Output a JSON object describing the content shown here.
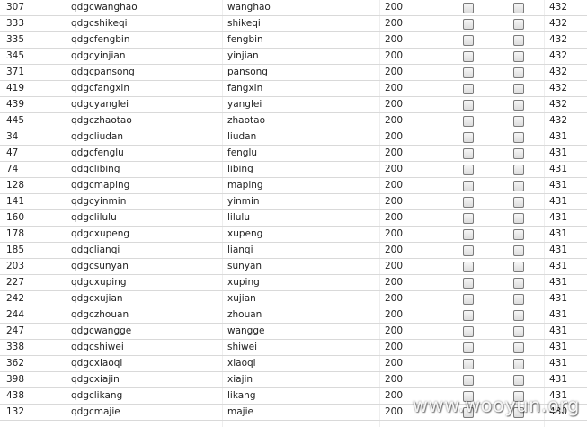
{
  "rows": [
    {
      "id": "307",
      "user": "qdgcwanghao",
      "name": "wanghao",
      "code": "200",
      "num": "432"
    },
    {
      "id": "333",
      "user": "qdgcshikeqi",
      "name": "shikeqi",
      "code": "200",
      "num": "432"
    },
    {
      "id": "335",
      "user": "qdgcfengbin",
      "name": "fengbin",
      "code": "200",
      "num": "432"
    },
    {
      "id": "345",
      "user": "qdgcyinjian",
      "name": "yinjian",
      "code": "200",
      "num": "432"
    },
    {
      "id": "371",
      "user": "qdgcpansong",
      "name": "pansong",
      "code": "200",
      "num": "432"
    },
    {
      "id": "419",
      "user": "qdgcfangxin",
      "name": "fangxin",
      "code": "200",
      "num": "432"
    },
    {
      "id": "439",
      "user": "qdgcyanglei",
      "name": "yanglei",
      "code": "200",
      "num": "432"
    },
    {
      "id": "445",
      "user": "qdgczhaotao",
      "name": "zhaotao",
      "code": "200",
      "num": "432"
    },
    {
      "id": "34",
      "user": "qdgcliudan",
      "name": "liudan",
      "code": "200",
      "num": "431"
    },
    {
      "id": "47",
      "user": "qdgcfenglu",
      "name": "fenglu",
      "code": "200",
      "num": "431"
    },
    {
      "id": "74",
      "user": "qdgclibing",
      "name": "libing",
      "code": "200",
      "num": "431"
    },
    {
      "id": "128",
      "user": "qdgcmaping",
      "name": "maping",
      "code": "200",
      "num": "431"
    },
    {
      "id": "141",
      "user": "qdgcyinmin",
      "name": "yinmin",
      "code": "200",
      "num": "431"
    },
    {
      "id": "160",
      "user": "qdgclilulu",
      "name": "lilulu",
      "code": "200",
      "num": "431"
    },
    {
      "id": "178",
      "user": "qdgcxupeng",
      "name": "xupeng",
      "code": "200",
      "num": "431"
    },
    {
      "id": "185",
      "user": "qdgclianqi",
      "name": "lianqi",
      "code": "200",
      "num": "431"
    },
    {
      "id": "203",
      "user": "qdgcsunyan",
      "name": "sunyan",
      "code": "200",
      "num": "431"
    },
    {
      "id": "227",
      "user": "qdgcxuping",
      "name": "xuping",
      "code": "200",
      "num": "431"
    },
    {
      "id": "242",
      "user": "qdgcxujian",
      "name": "xujian",
      "code": "200",
      "num": "431"
    },
    {
      "id": "244",
      "user": "qdgczhouan",
      "name": "zhouan",
      "code": "200",
      "num": "431"
    },
    {
      "id": "247",
      "user": "qdgcwangge",
      "name": "wangge",
      "code": "200",
      "num": "431"
    },
    {
      "id": "338",
      "user": "qdgcshiwei",
      "name": "shiwei",
      "code": "200",
      "num": "431"
    },
    {
      "id": "362",
      "user": "qdgcxiaoqi",
      "name": "xiaoqi",
      "code": "200",
      "num": "431"
    },
    {
      "id": "398",
      "user": "qdgcxiajin",
      "name": "xiajin",
      "code": "200",
      "num": "431"
    },
    {
      "id": "438",
      "user": "qdgclikang",
      "name": "likang",
      "code": "200",
      "num": "431"
    },
    {
      "id": "132",
      "user": "qdgcmajie",
      "name": "majie",
      "code": "200",
      "num": "430"
    }
  ],
  "watermark": "www.wooyun.org"
}
